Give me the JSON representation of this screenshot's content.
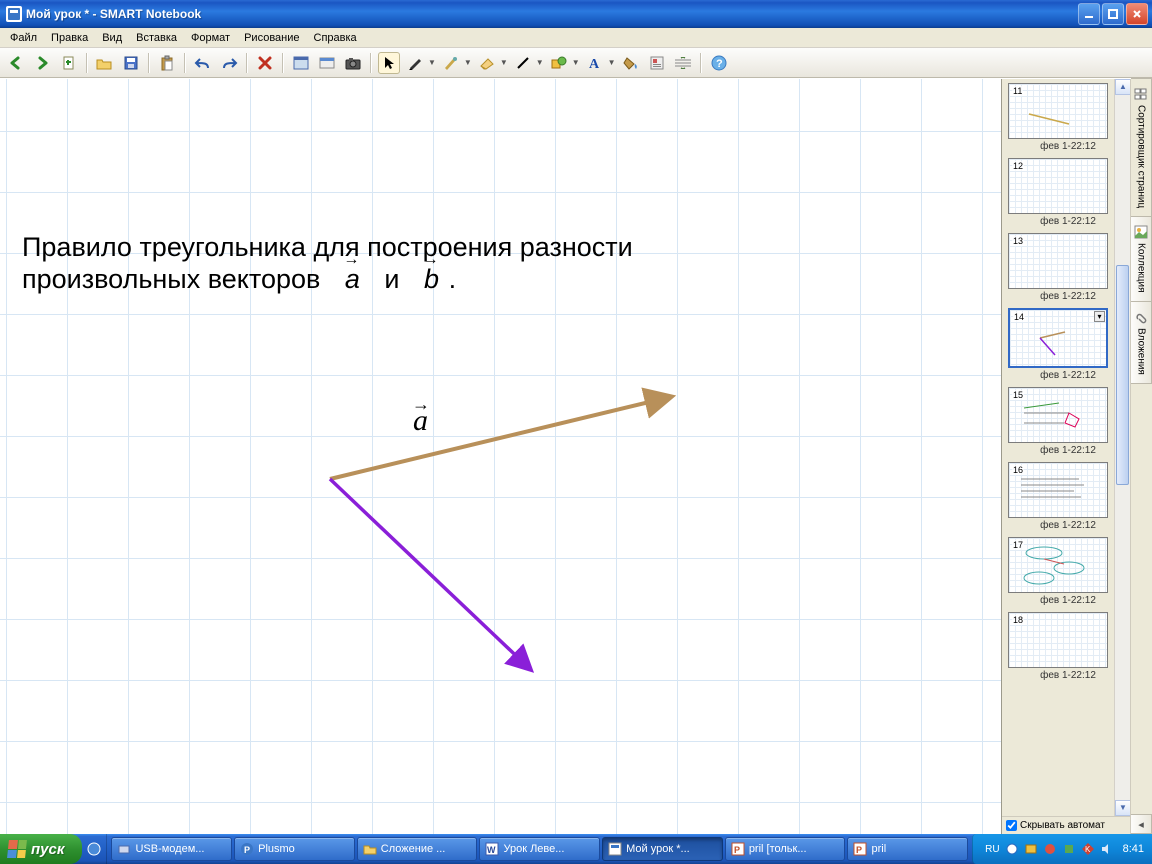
{
  "window": {
    "title": "Мой урок * - SMART Notebook"
  },
  "menu": {
    "items": [
      "Файл",
      "Правка",
      "Вид",
      "Вставка",
      "Формат",
      "Рисование",
      "Справка"
    ]
  },
  "toolbar_icons": [
    "prev-page",
    "next-page",
    "add-page",
    "sep",
    "open",
    "save",
    "sep",
    "paste",
    "sep",
    "undo",
    "redo",
    "sep",
    "delete",
    "sep",
    "fullscreen",
    "screen-capture",
    "camera",
    "sep",
    "pointer",
    "pen",
    "dropdown",
    "creative-pen",
    "dropdown",
    "eraser",
    "dropdown",
    "line",
    "dropdown",
    "shape",
    "dropdown",
    "text",
    "dropdown",
    "fill",
    "properties",
    "move-toolbar",
    "sep",
    "help"
  ],
  "lesson": {
    "line1": "Правило треугольника для построения разности",
    "line2_a": "произвольных векторов",
    "vec_a": "a",
    "between": "и",
    "vec_b": "b",
    "period": ".",
    "canvas_vec_label": "a"
  },
  "side": {
    "tab1": "Сортировщик страниц",
    "tab2": "Коллекция",
    "tab3": "Вложения",
    "hide_auto": "Скрывать автомат",
    "hide_auto_checked": true,
    "thumbs": [
      {
        "n": "11",
        "cap": "фев 1-22:12"
      },
      {
        "n": "12",
        "cap": "фев 1-22:12"
      },
      {
        "n": "13",
        "cap": "фев 1-22:12"
      },
      {
        "n": "14",
        "cap": "фев 1-22:12",
        "selected": true
      },
      {
        "n": "15",
        "cap": "фев 1-22:12"
      },
      {
        "n": "16",
        "cap": "фев 1-22:12"
      },
      {
        "n": "17",
        "cap": "фев 1-22:12"
      },
      {
        "n": "18",
        "cap": "фев 1-22:12"
      }
    ]
  },
  "taskbar": {
    "start": "пуск",
    "tasks": [
      {
        "label": "USB-модем...",
        "icon": "usb"
      },
      {
        "label": "Plusmo",
        "icon": "p"
      },
      {
        "label": "Сложение ...",
        "icon": "folder"
      },
      {
        "label": "Урок Леве...",
        "icon": "word"
      },
      {
        "label": "Мой урок *...",
        "icon": "smart",
        "active": true
      },
      {
        "label": "pril [тольк...",
        "icon": "ppt"
      },
      {
        "label": "pril",
        "icon": "ppt"
      }
    ],
    "lang": "RU",
    "clock": "8:41"
  }
}
